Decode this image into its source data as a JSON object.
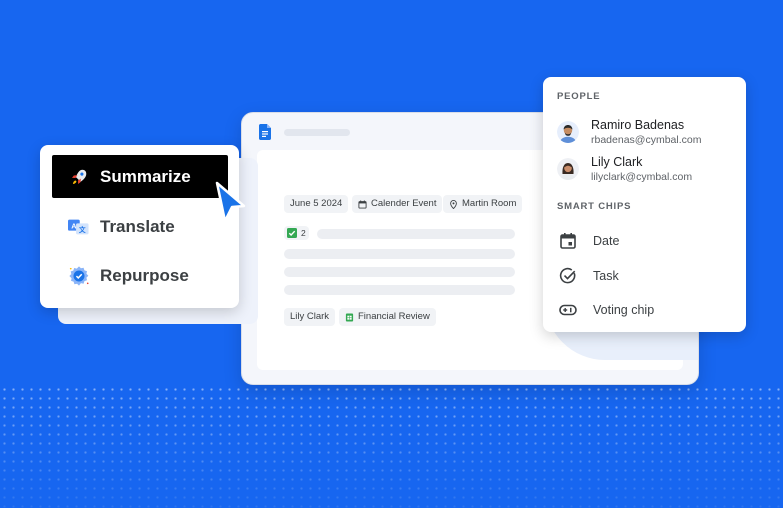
{
  "doc": {
    "chips": {
      "date": "June 5 2024",
      "event": "Calender Event",
      "room": "Martin Room",
      "checks": "2",
      "person": "Lily Clark",
      "file": "Financial Review"
    }
  },
  "menu": {
    "items": [
      {
        "label": "Summarize",
        "icon": "rocket-icon",
        "active": true
      },
      {
        "label": "Translate",
        "icon": "translate-icon",
        "active": false
      },
      {
        "label": "Repurpose",
        "icon": "repurpose-icon",
        "active": false
      }
    ]
  },
  "popover": {
    "people_heading": "PEOPLE",
    "people": [
      {
        "name": "Ramiro Badenas",
        "email": "rbadenas@cymbal.com"
      },
      {
        "name": "Lily Clark",
        "email": "lilyclark@cymbal.com"
      }
    ],
    "chips_heading": "SMART CHIPS",
    "smart_chips": [
      {
        "label": "Date",
        "icon": "calendar-icon"
      },
      {
        "label": "Task",
        "icon": "task-check-icon"
      },
      {
        "label": "Voting chip",
        "icon": "voting-chip-icon"
      }
    ]
  },
  "colors": {
    "background": "#1766f0",
    "accent": "#1a73e8",
    "active_item": "#000000"
  }
}
